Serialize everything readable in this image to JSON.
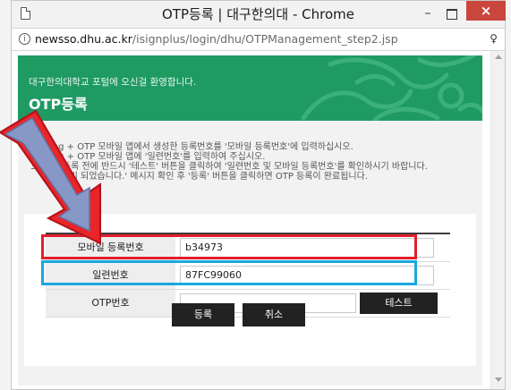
{
  "window": {
    "title": "OTP등록 | 대구한의대 - Chrome",
    "minimize_glyph": "–",
    "close_glyph": "×"
  },
  "address": {
    "host": "newsso.dhu.ac.kr",
    "path": "/isignplus/login/dhu/OTPManagement_step2.jsp"
  },
  "banner": {
    "welcome": "대구한의대학교 포털에 오신걸 환영합니다.",
    "title": "OTP등록"
  },
  "instructions": [
    "1. ISing + OTP 모바일 앱에서 생성한 등록번호를 '모바일 등록번호'에 입력하십시오.",
    "2. ISing + OTP 모바일 앱에 '일련번호'를 입력하여 주십시오.",
    "3. OTP 등록 전에 반드시 '테스트' 버튼을 클릭하여 '일련번호 및 모바일 등록번호'를 확인하시기 바랍니다.",
    "정상 처리 되었습니다.' 메시지 확인 후 '등록' 버튼을 클릭하면 OTP 등록이 완료됩니다."
  ],
  "form": {
    "mobile_label": "모바일 등록번호",
    "mobile_value": "b34973",
    "serial_label": "일련번호",
    "serial_value": "87FC99060",
    "otp_label": "OTP번호",
    "otp_value": "",
    "test_label": "테스트"
  },
  "actions": {
    "register_label": "등록",
    "cancel_label": "취소"
  },
  "colors": {
    "banner": "#1f9a63",
    "highlight_red": "#e0202e",
    "highlight_blue": "#1aa7e0",
    "close": "#c9463d",
    "button": "#222222"
  }
}
